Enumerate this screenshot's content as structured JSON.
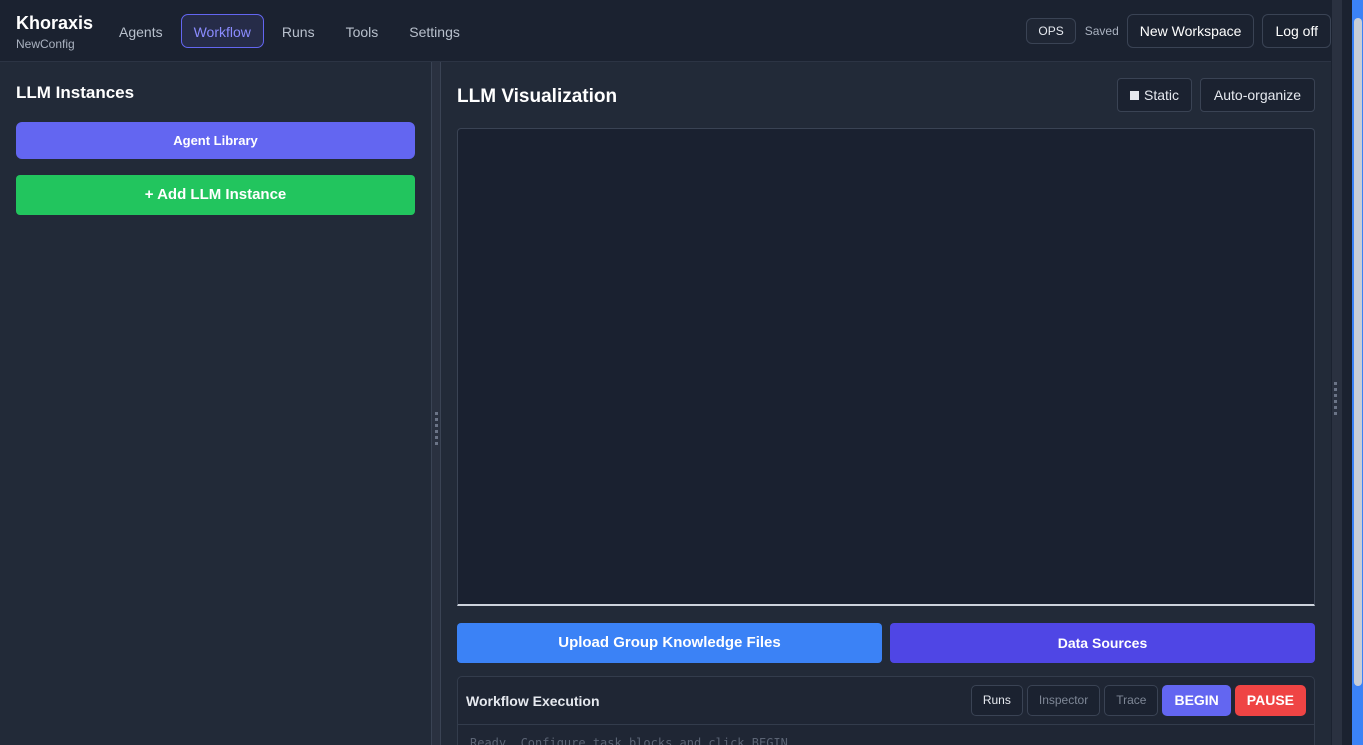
{
  "header": {
    "brand": "Khoraxis",
    "config": "NewConfig",
    "nav": [
      {
        "label": "Agents",
        "active": false
      },
      {
        "label": "Workflow",
        "active": true
      },
      {
        "label": "Runs",
        "active": false
      },
      {
        "label": "Tools",
        "active": false
      },
      {
        "label": "Settings",
        "active": false
      }
    ],
    "ops_badge": "OPS",
    "saved_status": "Saved",
    "new_workspace": "New Workspace",
    "log_off": "Log off"
  },
  "left": {
    "title": "LLM Instances",
    "agent_library": "Agent Library",
    "add_instance": "+ Add LLM Instance"
  },
  "main": {
    "title": "LLM Visualization",
    "static_toggle": "Static",
    "auto_organize": "Auto-organize",
    "upload_files": "Upload Group Knowledge Files",
    "data_sources": "Data Sources"
  },
  "execution": {
    "title": "Workflow Execution",
    "runs": "Runs",
    "inspector": "Inspector",
    "trace": "Trace",
    "begin": "BEGIN",
    "pause": "PAUSE",
    "log": "Ready. Configure task blocks and click BEGIN."
  },
  "colors": {
    "accent": "#6366f1",
    "add_green": "#22c55e",
    "upload_blue": "#3b82f6",
    "data_sources": "#4f46e5",
    "pause_red": "#ef4444"
  }
}
